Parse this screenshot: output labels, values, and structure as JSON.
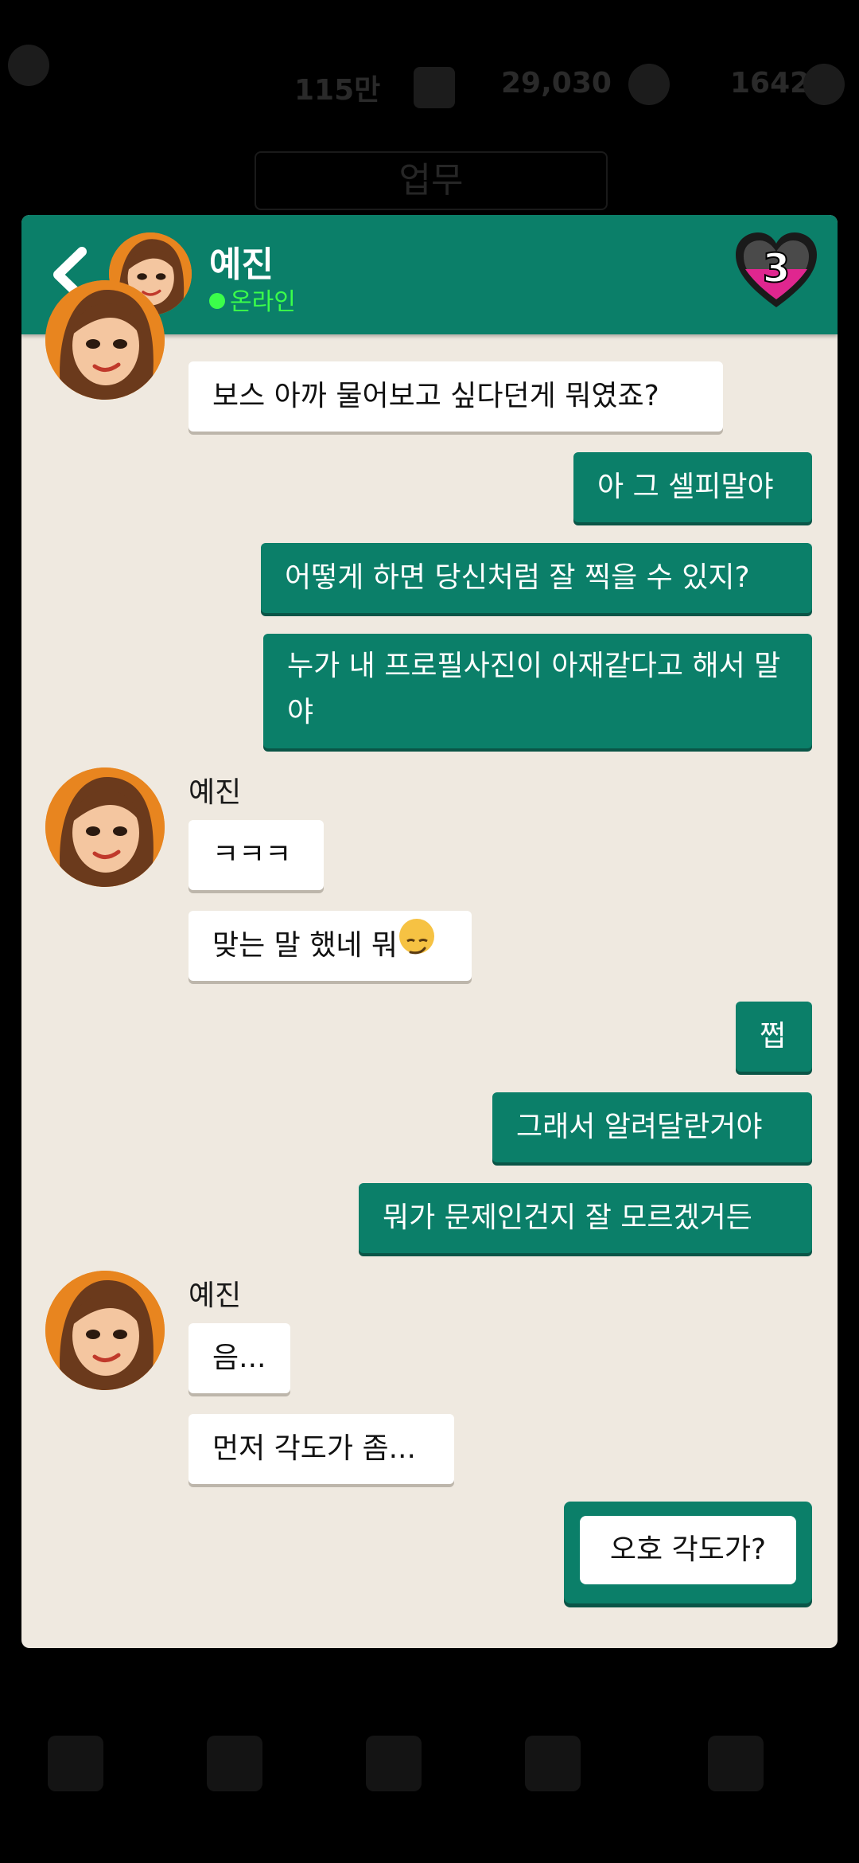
{
  "background": {
    "stats": [
      "115만",
      "29,030",
      "1642"
    ],
    "tab_label": "업무"
  },
  "header": {
    "name": "예진",
    "status": "온라인",
    "heart_level": "3"
  },
  "messages": [
    {
      "from": "her",
      "text": "보스 아까 물어보고 싶다던게 뭐였죠?"
    },
    {
      "from": "me",
      "text": "아 그 셀피말야"
    },
    {
      "from": "me",
      "text": "어떻게 하면 당신처럼 잘 찍을 수 있지?"
    },
    {
      "from": "me",
      "text": "누가 내 프로필사진이 아재같다고 해서 말야"
    },
    {
      "from": "her",
      "sender": "예진",
      "text": "ㅋㅋㅋ"
    },
    {
      "from": "her",
      "text": "맞는 말 했네 뭐"
    },
    {
      "from": "me",
      "text": "쩝"
    },
    {
      "from": "me",
      "text": "그래서 알려달란거야"
    },
    {
      "from": "me",
      "text": "뭐가 문제인건지 잘 모르겠거든"
    },
    {
      "from": "her",
      "sender": "예진",
      "text": "음..."
    },
    {
      "from": "her",
      "text": "먼저 각도가 좀..."
    }
  ],
  "reply_choice": "오호 각도가?",
  "colors": {
    "header_green": "#0b7f69",
    "chat_bg": "#efe9e0",
    "online_green": "#3bff4a",
    "heart_pink": "#e0268f"
  },
  "icons": {
    "back": "chevron-left-icon",
    "heart": "heart-level-icon",
    "emoji": "smirk-emoji-icon"
  }
}
